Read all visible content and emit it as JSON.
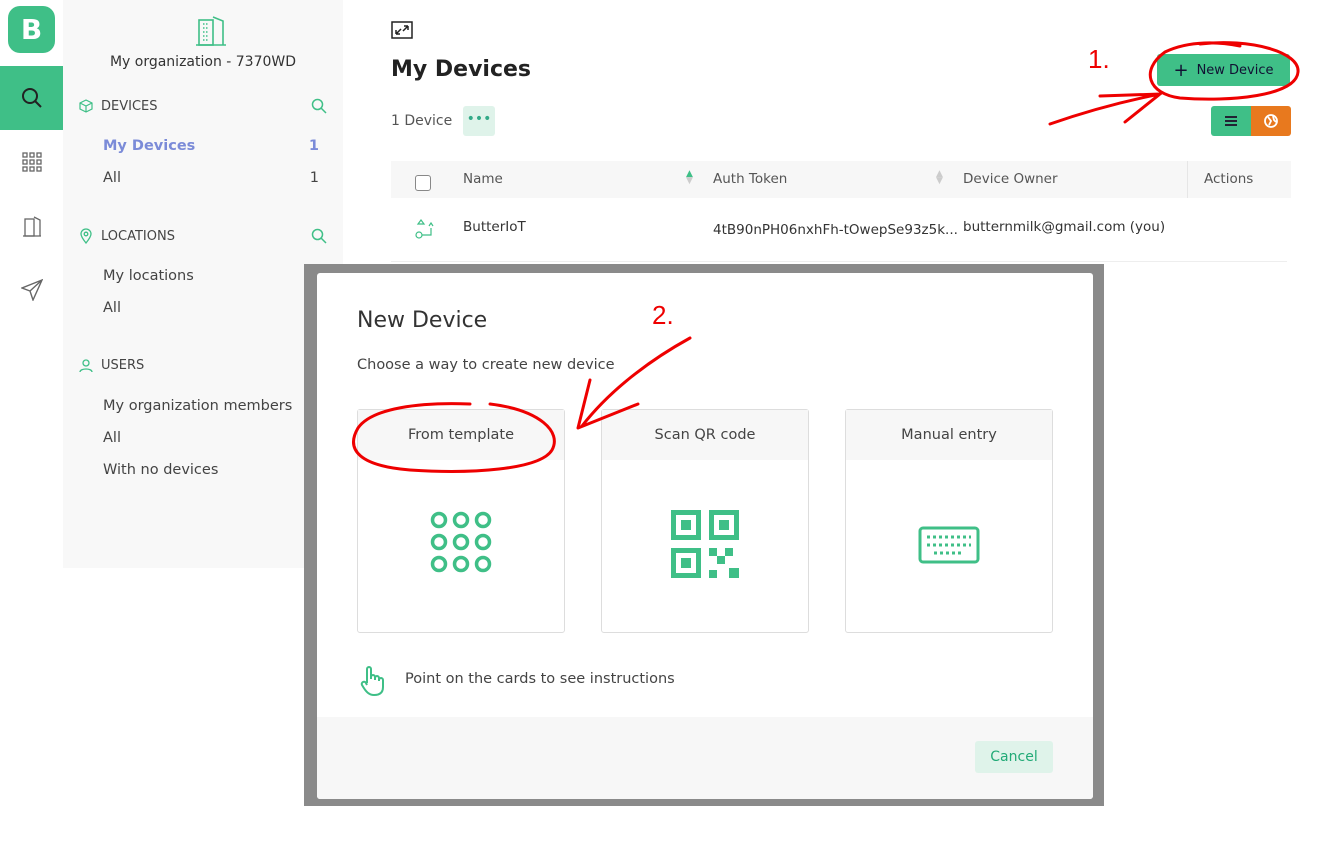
{
  "rail": {
    "logo": "B",
    "items": [
      "search-icon",
      "apps-icon",
      "organization-icon",
      "send-icon"
    ]
  },
  "sidebar": {
    "org_name": "My organization - 7370WD",
    "devices": {
      "title": "DEVICES",
      "items": [
        {
          "label": "My Devices",
          "count": "1"
        },
        {
          "label": "All",
          "count": "1"
        }
      ]
    },
    "locations": {
      "title": "LOCATIONS",
      "items": [
        {
          "label": "My locations"
        },
        {
          "label": "All"
        }
      ]
    },
    "users": {
      "title": "USERS",
      "items": [
        {
          "label": "My organization members"
        },
        {
          "label": "All"
        },
        {
          "label": "With no devices"
        }
      ]
    }
  },
  "main": {
    "title": "My Devices",
    "device_count": "1 Device",
    "more": "•••",
    "new_device": "New Device",
    "table": {
      "headers": [
        "Name",
        "Auth Token",
        "Device Owner",
        "Actions"
      ],
      "rows": [
        {
          "name": "ButterIoT",
          "token": "4tB90nPH06nxhFh-tOwepSe93z5k...",
          "owner": "butternmilk@gmail.com (you)"
        }
      ]
    }
  },
  "modal": {
    "title": "New Device",
    "subtitle": "Choose a way to create new device",
    "cards": [
      {
        "label": "From template"
      },
      {
        "label": "Scan QR code"
      },
      {
        "label": "Manual entry"
      }
    ],
    "hint": "Point on the cards to see instructions",
    "cancel": "Cancel"
  },
  "annotations": {
    "step1": "1.",
    "step2": "2."
  },
  "colors": {
    "accent": "#3fbf87",
    "active_link": "#7b8bd8",
    "annotation": "#ee0000",
    "orange": "#e8791e"
  }
}
